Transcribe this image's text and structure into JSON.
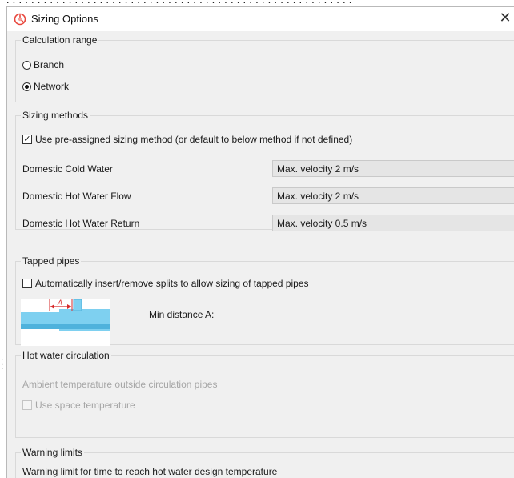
{
  "window": {
    "title": "Sizing Options",
    "close_glyph": "✕"
  },
  "calculation_range": {
    "legend": "Calculation range",
    "options": [
      {
        "label": "Branch",
        "selected": false
      },
      {
        "label": "Network",
        "selected": true
      }
    ]
  },
  "sizing_methods": {
    "legend": "Sizing methods",
    "preassigned": {
      "label": "Use pre-assigned sizing method (or default to below method if not defined)",
      "checked": true
    },
    "rows": [
      {
        "label": "Domestic Cold Water",
        "value": "Max. velocity 2 m/s"
      },
      {
        "label": "Domestic Hot Water Flow",
        "value": "Max. velocity 2 m/s"
      },
      {
        "label": "Domestic Hot Water Return",
        "value": "Max. velocity 0.5 m/s"
      }
    ]
  },
  "tapped_pipes": {
    "legend": "Tapped pipes",
    "auto_split": {
      "label": "Automatically insert/remove splits to allow sizing of tapped pipes",
      "checked": false
    },
    "diagram_letter": "A",
    "min_distance_label": "Min distance A:"
  },
  "hot_water_circulation": {
    "legend": "Hot water circulation",
    "ambient_label": "Ambient temperature outside circulation pipes",
    "use_space_temp": {
      "label": "Use space temperature",
      "checked": false,
      "enabled": false
    }
  },
  "warning_limits": {
    "legend": "Warning limits",
    "time_limit_label": "Warning limit for time to reach hot water design temperature"
  },
  "icons": {
    "app": "sizing-app-icon",
    "close": "close-icon",
    "diagram": "tapped-pipe-diagram"
  },
  "colors": {
    "accent": "#e8463c",
    "dialog_bg": "#f0f0f0",
    "combo_bg": "#e5e5e5",
    "disabled_text": "#a6a6a6",
    "diagram_blue": "#7ed0f0"
  }
}
